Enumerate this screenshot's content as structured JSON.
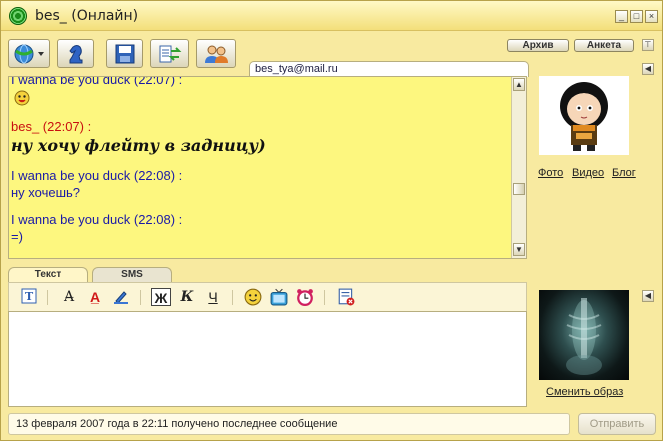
{
  "window": {
    "title": "bes_ (Онлайн)",
    "minimize": "_",
    "maximize": "□",
    "close": "×"
  },
  "toolbar": {
    "buttons": [
      {
        "name": "status-menu",
        "icon": "globe-arrow-icon"
      },
      {
        "name": "chess",
        "icon": "chess-knight-icon"
      },
      {
        "name": "save",
        "icon": "floppy-disk-icon"
      },
      {
        "name": "file-transfer",
        "icon": "file-transfer-icon"
      },
      {
        "name": "contacts",
        "icon": "users-icon"
      }
    ],
    "archive_label": "Архив",
    "profile_label": "Анкета"
  },
  "contact": {
    "email": "bes_tya@mail.ru"
  },
  "chat": {
    "messages": [
      {
        "author": "I wanna be you duck",
        "time": "(22:07) :",
        "header": "I wanna be you duck (22:07) :",
        "body": "",
        "emoji": "smiley-icon",
        "color": "#1a1aa8"
      },
      {
        "author": "bes_",
        "time": "(22:07) :",
        "header": "bes_ (22:07) :",
        "body": "ну хочу флейту в задницу)",
        "color": "#c81010"
      },
      {
        "author": "I wanna be you duck",
        "time": "(22:08) :",
        "header": "I wanna be you duck (22:08) :",
        "body": "ну хочешь?",
        "color": "#1a1aa8"
      },
      {
        "author": "I wanna be you duck",
        "time": "(22:08) :",
        "header": "I wanna be you duck (22:08) :",
        "body": "=)",
        "color": "#1a1aa8"
      }
    ]
  },
  "avatar_links": {
    "photo": "Фото",
    "video": "Видео",
    "blog": "Блог"
  },
  "tabs": {
    "text": "Текст",
    "sms": "SMS"
  },
  "format_toolbar": {
    "bold": "Ж",
    "italic": "К",
    "underline": "Ч"
  },
  "message_input": {
    "value": ""
  },
  "change_image_label": "Сменить образ",
  "status": {
    "text": "13 февраля 2007 года в 22:11 получено последнее сообщение"
  },
  "send_label": "Отправить",
  "colors": {
    "chat_bg": "#fdf77f",
    "window_bg": "#f8eaa0",
    "other_user": "#1a1aa8",
    "self_user": "#c81010"
  }
}
